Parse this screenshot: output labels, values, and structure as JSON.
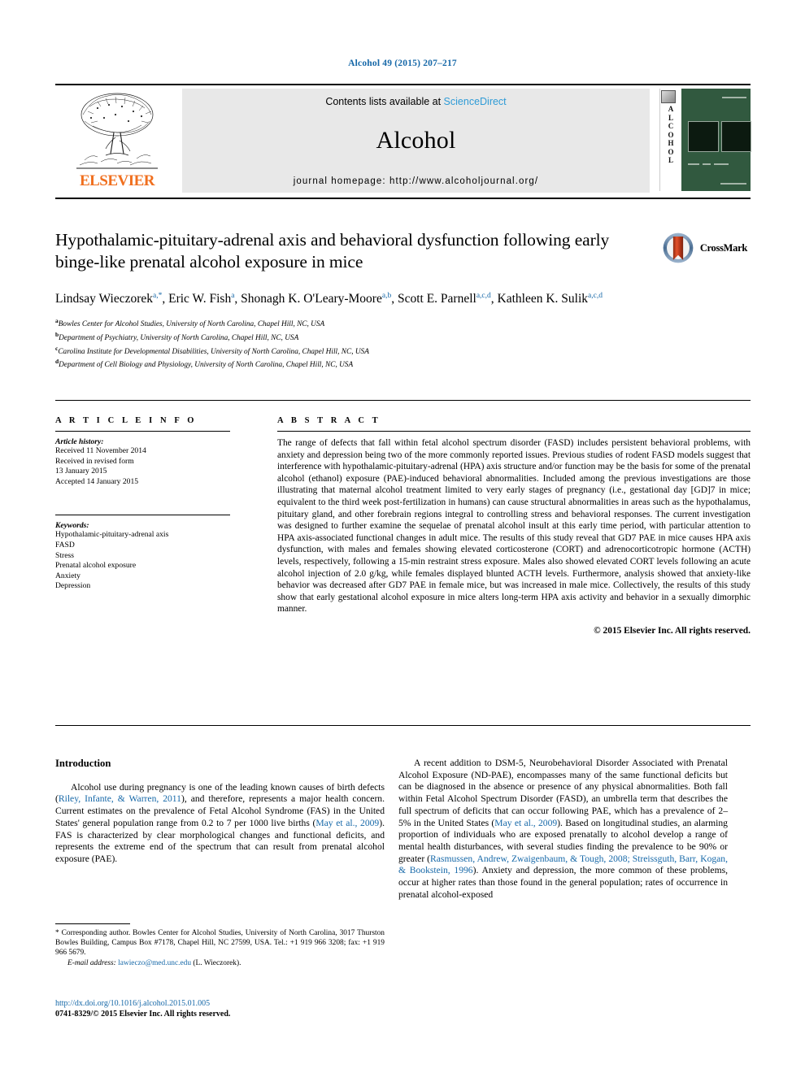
{
  "running_head": "Alcohol 49 (2015) 207–217",
  "header": {
    "contents_prefix": "Contents lists available at ",
    "sciencedirect": "ScienceDirect",
    "journal_name": "Alcohol",
    "homepage": "journal homepage: http://www.alcoholjournal.org/",
    "publisher_logo_text": "ELSEVIER",
    "cover_letters": [
      "A",
      "L",
      "C",
      "O",
      "H",
      "O",
      "L"
    ],
    "accent_color": "#2e9bd6",
    "elsevier_orange": "#f06f1e",
    "cover_green": "#31593f"
  },
  "article": {
    "title": "Hypothalamic-pituitary-adrenal axis and behavioral dysfunction following early binge-like prenatal alcohol exposure in mice",
    "crossmark_label": "CrossMark",
    "authors_html": "Lindsay Wieczorek<sup>a,*</sup>, Eric W. Fish<sup>a</sup>, Shonagh K. O'Leary-Moore<sup>a,b</sup>, Scott E. Parnell<sup>a,c,d</sup>, Kathleen K. Sulik<sup>a,c,d</sup>",
    "affiliations": [
      {
        "marker": "a",
        "text": "Bowles Center for Alcohol Studies, University of North Carolina, Chapel Hill, NC, USA"
      },
      {
        "marker": "b",
        "text": "Department of Psychiatry, University of North Carolina, Chapel Hill, NC, USA"
      },
      {
        "marker": "c",
        "text": "Carolina Institute for Developmental Disabilities, University of North Carolina, Chapel Hill, NC, USA"
      },
      {
        "marker": "d",
        "text": "Department of Cell Biology and Physiology, University of North Carolina, Chapel Hill, NC, USA"
      }
    ]
  },
  "article_info": {
    "heading": "A R T I C L E   I N F O",
    "history_label": "Article history:",
    "history_lines": [
      "Received 11 November 2014",
      "Received in revised form",
      "13 January 2015",
      "Accepted 14 January 2015"
    ],
    "keywords_label": "Keywords:",
    "keywords": [
      "Hypothalamic-pituitary-adrenal axis",
      "FASD",
      "Stress",
      "Prenatal alcohol exposure",
      "Anxiety",
      "Depression"
    ]
  },
  "abstract": {
    "heading": "A B S T R A C T",
    "text": "The range of defects that fall within fetal alcohol spectrum disorder (FASD) includes persistent behavioral problems, with anxiety and depression being two of the more commonly reported issues. Previous studies of rodent FASD models suggest that interference with hypothalamic-pituitary-adrenal (HPA) axis structure and/or function may be the basis for some of the prenatal alcohol (ethanol) exposure (PAE)-induced behavioral abnormalities. Included among the previous investigations are those illustrating that maternal alcohol treatment limited to very early stages of pregnancy (i.e., gestational day [GD]7 in mice; equivalent to the third week post-fertilization in humans) can cause structural abnormalities in areas such as the hypothalamus, pituitary gland, and other forebrain regions integral to controlling stress and behavioral responses. The current investigation was designed to further examine the sequelae of prenatal alcohol insult at this early time period, with particular attention to HPA axis-associated functional changes in adult mice. The results of this study reveal that GD7 PAE in mice causes HPA axis dysfunction, with males and females showing elevated corticosterone (CORT) and adrenocorticotropic hormone (ACTH) levels, respectively, following a 15-min restraint stress exposure. Males also showed elevated CORT levels following an acute alcohol injection of 2.0 g/kg, while females displayed blunted ACTH levels. Furthermore, analysis showed that anxiety-like behavior was decreased after GD7 PAE in female mice, but was increased in male mice. Collectively, the results of this study show that early gestational alcohol exposure in mice alters long-term HPA axis activity and behavior in a sexually dimorphic manner.",
    "copyright": "© 2015 Elsevier Inc. All rights reserved."
  },
  "body": {
    "intro_heading": "Introduction",
    "left_paragraph_parts": [
      "Alcohol use during pregnancy is one of the leading known causes of birth defects (",
      "Riley, Infante, & Warren, 2011",
      "), and therefore, represents a major health concern. Current estimates on the prevalence of Fetal Alcohol Syndrome (FAS) in the United States' general population range from 0.2 to 7 per 1000 live births (",
      "May et al., 2009",
      "). FAS is characterized by clear morphological changes and functional deficits, and represents the extreme end of the spectrum that can result from prenatal alcohol exposure (PAE)."
    ],
    "right_paragraph_parts": [
      "A recent addition to DSM-5, Neurobehavioral Disorder Associated with Prenatal Alcohol Exposure (ND-PAE), encompasses many of the same functional deficits but can be diagnosed in the absence or presence of any physical abnormalities. Both fall within Fetal Alcohol Spectrum Disorder (FASD), an umbrella term that describes the full spectrum of deficits that can occur following PAE, which has a prevalence of 2–5% in the United States (",
      "May et al., 2009",
      "). Based on longitudinal studies, an alarming proportion of individuals who are exposed prenatally to alcohol develop a range of mental health disturbances, with several studies finding the prevalence to be 90% or greater (",
      "Rasmussen, Andrew, Zwaigenbaum, & Tough, 2008; Streissguth, Barr, Kogan, & Bookstein, 1996",
      "). Anxiety and depression, the more common of these problems, occur at higher rates than those found in the general population; rates of occurrence in prenatal alcohol-exposed"
    ]
  },
  "footnote": {
    "corresponding": "* Corresponding author. Bowles Center for Alcohol Studies, University of North Carolina, 3017 Thurston Bowles Building, Campus Box #7178, Chapel Hill, NC 27599, USA. Tel.: +1 919 966 3208; fax: +1 919 966 5679.",
    "email_label": "E-mail address:",
    "email": "lawieczo@med.unc.edu",
    "email_suffix": "(L. Wieczorek).",
    "doi": "http://dx.doi.org/10.1016/j.alcohol.2015.01.005",
    "issn": "0741-8329/© 2015 Elsevier Inc. All rights reserved."
  }
}
